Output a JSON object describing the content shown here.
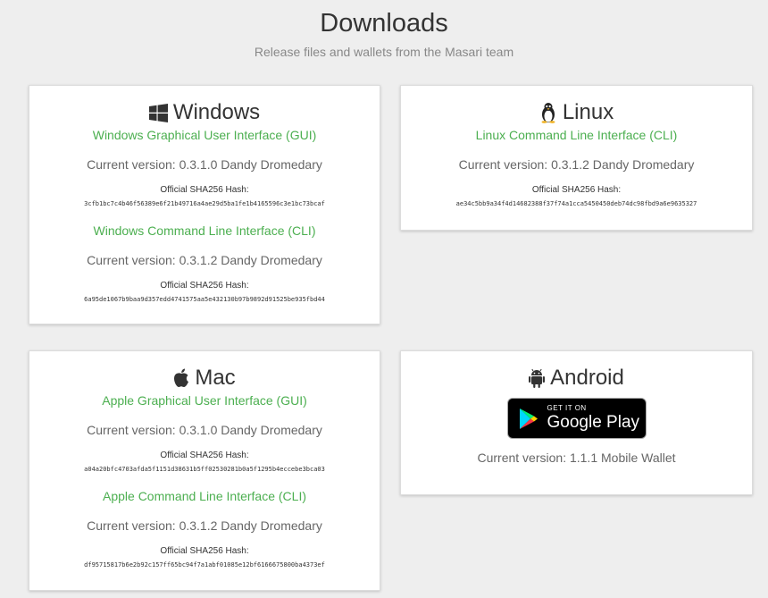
{
  "header": {
    "title": "Downloads",
    "subtitle": "Release files and wallets from the Masari team"
  },
  "windows": {
    "title": "Windows",
    "icon": "windows-icon",
    "gui": {
      "link": "Windows Graphical User Interface (GUI)",
      "version": "Current version: 0.3.1.0 Dandy Dromedary",
      "hash_label": "Official SHA256 Hash:",
      "hash": "3cfb1bc7c4b46f56389e6f21b49716a4ae29d5ba1fe1b4165596c3e1bc73bcaf"
    },
    "cli": {
      "link": "Windows Command Line Interface (CLI)",
      "version": "Current version: 0.3.1.2 Dandy Dromedary",
      "hash_label": "Official SHA256 Hash:",
      "hash": "6a95de1067b9baa9d357edd4741575aa5e432130b97b9892d91525be935fbd44"
    }
  },
  "linux": {
    "title": "Linux",
    "icon": "linux-tux-icon",
    "cli": {
      "link": "Linux Command Line Interface (CLI)",
      "version": "Current version: 0.3.1.2 Dandy Dromedary",
      "hash_label": "Official SHA256 Hash:",
      "hash": "ae34c5bb9a34f4d14682388f37f74a1cca5450450deb74dc98fbd9a6e9635327"
    }
  },
  "mac": {
    "title": "Mac",
    "icon": "apple-icon",
    "gui": {
      "link": "Apple Graphical User Interface (GUI)",
      "version": "Current version: 0.3.1.0 Dandy Dromedary",
      "hash_label": "Official SHA256 Hash:",
      "hash": "a04a20bfc4703afda5f1151d38631b5ff02530281b0a5f1295b4eccebe3bca03"
    },
    "cli": {
      "link": "Apple Command Line Interface (CLI)",
      "version": "Current version: 0.3.1.2 Dandy Dromedary",
      "hash_label": "Official SHA256 Hash:",
      "hash": "df95715817b6e2b92c157ff65bc94f7a1abf01085e12bf6166675800ba4373ef"
    }
  },
  "android": {
    "title": "Android",
    "icon": "android-icon",
    "badge_small": "GET IT ON",
    "badge_big": "Google Play",
    "version": "Current version: 1.1.1 Mobile Wallet"
  },
  "colors": {
    "link": "#4caf50",
    "background": "#eeeeee",
    "card": "#ffffff"
  }
}
